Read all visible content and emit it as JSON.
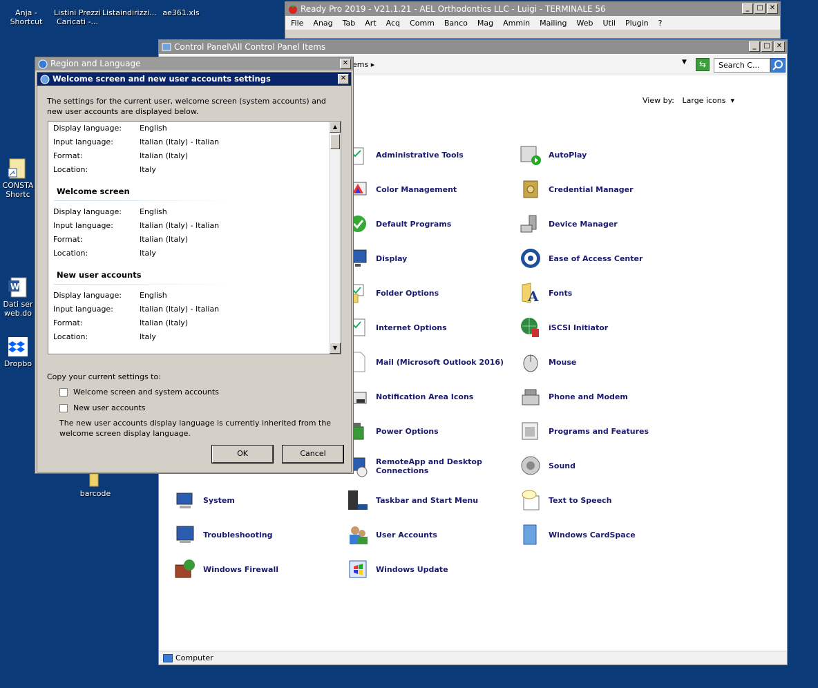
{
  "desktop": {
    "icons": [
      {
        "label": "Anja -\nShortcut"
      },
      {
        "label": "Listini Prezzi\nCaricati -..."
      },
      {
        "label": "Listaindirizzi..."
      },
      {
        "label": "ae361.xls"
      },
      {
        "label": "CONSTA\nShortc"
      },
      {
        "label": "Dati ser\nweb.do"
      },
      {
        "label": "Dropbo"
      },
      {
        "label": "barcode"
      }
    ]
  },
  "readypro": {
    "title": "Ready Pro 2019 - V21.1.21 - AEL Orthodontics LLC - Luigi - TERMINALE 56",
    "menu": [
      "File",
      "Anag",
      "Tab",
      "Art",
      "Acq",
      "Comm",
      "Banco",
      "Mag",
      "Ammin",
      "Mailing",
      "Web",
      "Util",
      "Plugin",
      "?"
    ]
  },
  "cpanel": {
    "title": "Control Panel\\All Control Panel Items",
    "breadcrumb": "ems",
    "search_placeholder": "Search C...",
    "view_by_label": "View by:",
    "view_by_value": "Large icons",
    "status": "Computer",
    "items": [
      {
        "label": "Administrative Tools",
        "icon": "admin-tools-icon"
      },
      {
        "label": "AutoPlay",
        "icon": "autoplay-icon"
      },
      {
        "label": "Color Management",
        "icon": "color-management-icon"
      },
      {
        "label": "Credential Manager",
        "icon": "credential-manager-icon"
      },
      {
        "label": "Default Programs",
        "icon": "default-programs-icon"
      },
      {
        "label": "Device Manager",
        "icon": "device-manager-icon"
      },
      {
        "label": "Display",
        "icon": "display-icon"
      },
      {
        "label": "Ease of Access Center",
        "icon": "ease-of-access-icon"
      },
      {
        "label": "Folder Options",
        "icon": "folder-options-icon"
      },
      {
        "label": "Fonts",
        "icon": "fonts-icon"
      },
      {
        "label": "Internet Options",
        "icon": "internet-options-icon"
      },
      {
        "label": "iSCSI Initiator",
        "icon": "iscsi-icon"
      },
      {
        "label": "Mail (Microsoft Outlook 2016)",
        "icon": "mail-icon"
      },
      {
        "label": "Mouse",
        "icon": "mouse-icon"
      },
      {
        "label": "Notification Area Icons",
        "icon": "notification-icon"
      },
      {
        "label": "Phone and Modem",
        "icon": "phone-modem-icon"
      },
      {
        "label": "Power Options",
        "icon": "power-options-icon"
      },
      {
        "label": "Programs and Features",
        "icon": "programs-features-icon"
      },
      {
        "label": "RemoteApp and Desktop\nConnections",
        "icon": "remoteapp-icon"
      },
      {
        "label": "Sound",
        "icon": "sound-icon"
      },
      {
        "label": "System",
        "icon": "system-icon"
      },
      {
        "label": "Taskbar and Start Menu",
        "icon": "taskbar-icon"
      },
      {
        "label": "Text to Speech",
        "icon": "text-to-speech-icon"
      },
      {
        "label": "Troubleshooting",
        "icon": "troubleshooting-icon"
      },
      {
        "label": "User Accounts",
        "icon": "user-accounts-icon"
      },
      {
        "label": "Windows CardSpace",
        "icon": "cardspace-icon"
      },
      {
        "label": "Windows Firewall",
        "icon": "firewall-icon"
      },
      {
        "label": "Windows Update",
        "icon": "windows-update-icon"
      }
    ]
  },
  "region": {
    "title": "Region and Language"
  },
  "welcome": {
    "title": "Welcome screen and new user accounts settings",
    "intro": "The settings for the current user, welcome screen (system accounts) and new user accounts are displayed below.",
    "keys": {
      "display": "Display language:",
      "input": "Input language:",
      "format": "Format:",
      "location": "Location:"
    },
    "current": {
      "display": "English",
      "input": "Italian (Italy) - Italian",
      "format": "Italian (Italy)",
      "location": "Italy"
    },
    "welcome_section": {
      "heading": "Welcome screen",
      "display": "English",
      "input": "Italian (Italy) - Italian",
      "format": "Italian (Italy)",
      "location": "Italy"
    },
    "newuser_section": {
      "heading": "New user accounts",
      "display": "English",
      "input": "Italian (Italy) - Italian",
      "format": "Italian (Italy)",
      "location": "Italy"
    },
    "copy_label": "Copy your current settings to:",
    "chk_welcome": "Welcome screen and system accounts",
    "chk_newuser": "New user accounts",
    "note": "The new user accounts display language is currently inherited from the welcome screen display language.",
    "ok": "OK",
    "cancel": "Cancel"
  }
}
